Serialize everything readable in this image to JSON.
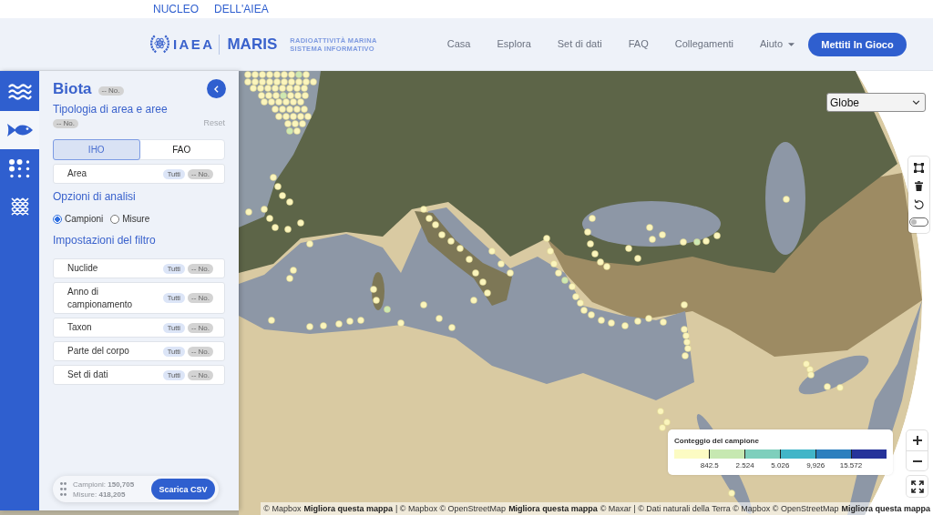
{
  "top_links": [
    "NUCLEO",
    "DELL'AIEA"
  ],
  "header": {
    "logo": {
      "org": "IAEA",
      "product": "MARIS",
      "tagline": [
        "RADIOATTIVITÀ MARINA",
        "SISTEMA INFORMATIVO"
      ]
    },
    "nav": [
      {
        "label": "Casa",
        "kind": "link"
      },
      {
        "label": "Esplora",
        "kind": "link"
      },
      {
        "label": "Set di dati",
        "kind": "link"
      },
      {
        "label": "FAQ",
        "kind": "link"
      },
      {
        "label": "Collegamenti",
        "kind": "link"
      },
      {
        "label": "Aiuto",
        "kind": "dropdown"
      }
    ],
    "cta_button": "Mettiti In Gioco"
  },
  "rail": [
    {
      "selected": false
    },
    {
      "selected": true
    },
    {
      "selected": false
    },
    {
      "selected": false
    }
  ],
  "panel": {
    "title": "Biota",
    "title_badge": "-- No.",
    "area_type": {
      "heading": "Tipologia di area e aree",
      "badge": "-- No.",
      "reset": "Reset",
      "tabs": [
        {
          "label": "IHO",
          "selected": true
        },
        {
          "label": "FAO",
          "selected": false
        }
      ],
      "area_filter": {
        "label": "Area",
        "all_badge": "Tutti",
        "none_badge": "-- No."
      }
    },
    "analysis": {
      "heading": "Opzioni di analisi",
      "options": [
        {
          "label": "Campioni",
          "selected": true
        },
        {
          "label": "Misure",
          "selected": false
        }
      ]
    },
    "filters": {
      "heading": "Impostazioni del filtro",
      "rows": [
        {
          "label": "Nuclide",
          "all_badge": "Tutti",
          "none_badge": "-- No."
        },
        {
          "label": "Anno di campionamento",
          "all_badge": "Tutti",
          "none_badge": "-- No."
        },
        {
          "label": "Taxon",
          "all_badge": "Tutti",
          "none_badge": "-- No."
        },
        {
          "label": "Parte del corpo",
          "all_badge": "Tutti",
          "none_badge": "-- No."
        },
        {
          "label": "Set di dati",
          "all_badge": "Tutti",
          "none_badge": "-- No."
        }
      ]
    },
    "footer": {
      "counts": [
        "Campioni: **150,705**",
        "Misure: **418,205**"
      ],
      "download_button": "Scarica CSV"
    }
  },
  "map": {
    "projection_select": "Globe",
    "draw_toolbar": {
      "toggle_on": false
    },
    "legend": {
      "title": "Conteggio del campione",
      "bins": [
        {
          "color": "#fcfbc3"
        },
        {
          "color": "#c6e8b1"
        },
        {
          "color": "#7ecfbc"
        },
        {
          "color": "#41b5c8"
        },
        {
          "color": "#2c7fbe"
        },
        {
          "color": "#26339a"
        }
      ],
      "ticks": [
        "842.5",
        "2.524",
        "5.026",
        "9,926",
        "15.572"
      ]
    },
    "attribution": [
      {
        "kind": "text",
        "text": "© Mapbox"
      },
      {
        "kind": "link",
        "text": "Migliora questa mappa"
      },
      {
        "kind": "text",
        "text": "| © Mapbox © OpenStreetMap"
      },
      {
        "kind": "link",
        "text": "Migliora questa mappa"
      },
      {
        "kind": "text",
        "text": "© Maxar | © Dati naturali della Terra © Mapbox © OpenStreetMap"
      },
      {
        "kind": "link",
        "text": "Migliora questa mappa"
      }
    ]
  }
}
